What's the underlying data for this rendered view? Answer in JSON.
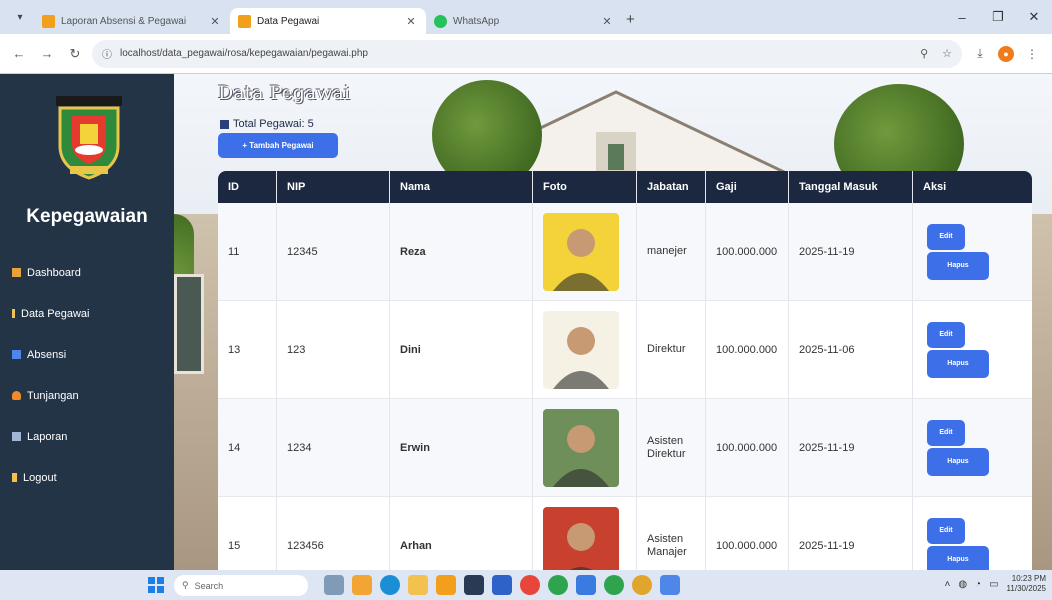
{
  "browser": {
    "tabs": [
      {
        "title": "Laporan Absensi & Pegawai",
        "active": false
      },
      {
        "title": "Data Pegawai",
        "active": true
      },
      {
        "title": "WhatsApp",
        "active": false
      }
    ],
    "url": "localhost/data_pegawai/rosa/kepegawaian/pegawai.php"
  },
  "sidebar": {
    "brand": "Kepegawaian",
    "items": [
      {
        "label": "Dashboard",
        "icon": "dashboard-icon",
        "color": "#e8a33a"
      },
      {
        "label": "Data Pegawai",
        "icon": "users-icon",
        "color": "#f2c14e"
      },
      {
        "label": "Absensi",
        "icon": "calendar-icon",
        "color": "#4f87e8"
      },
      {
        "label": "Tunjangan",
        "icon": "gift-icon",
        "color": "#f08a2a"
      },
      {
        "label": "Laporan",
        "icon": "report-icon",
        "color": "#9fb6d6"
      },
      {
        "label": "Logout",
        "icon": "logout-icon",
        "color": "#f2c14e"
      }
    ]
  },
  "page": {
    "title": "Data Pegawai",
    "total_label": "Total Pegawai: 5",
    "add_button": "+ Tambah Pegawai"
  },
  "table": {
    "headers": [
      "ID",
      "NIP",
      "Nama",
      "Foto",
      "Jabatan",
      "Gaji",
      "Tanggal Masuk",
      "Aksi"
    ],
    "edit_label": "Edit",
    "delete_label": "Hapus",
    "rows": [
      {
        "id": "11",
        "nip": "12345",
        "nama": "Reza",
        "jabatan": "manejer",
        "gaji": "100.000.000",
        "tanggal": "2025-11-19",
        "photo_bg": "#f3d23a"
      },
      {
        "id": "13",
        "nip": "123",
        "nama": "Dini",
        "jabatan": "Direktur",
        "gaji": "100.000.000",
        "tanggal": "2025-11-06",
        "photo_bg": "#f5f1e4"
      },
      {
        "id": "14",
        "nip": "1234",
        "nama": "Erwin",
        "jabatan": "Asisten Direktur",
        "gaji": "100.000.000",
        "tanggal": "2025-11-19",
        "photo_bg": "#6f8f5a"
      },
      {
        "id": "15",
        "nip": "123456",
        "nama": "Arhan",
        "jabatan": "Asisten Manajer",
        "gaji": "100.000.000",
        "tanggal": "2025-11-19",
        "photo_bg": "#c8412f"
      }
    ]
  },
  "taskbar": {
    "search_placeholder": "Search",
    "time": "10:23 PM",
    "date": "11/30/2025"
  }
}
